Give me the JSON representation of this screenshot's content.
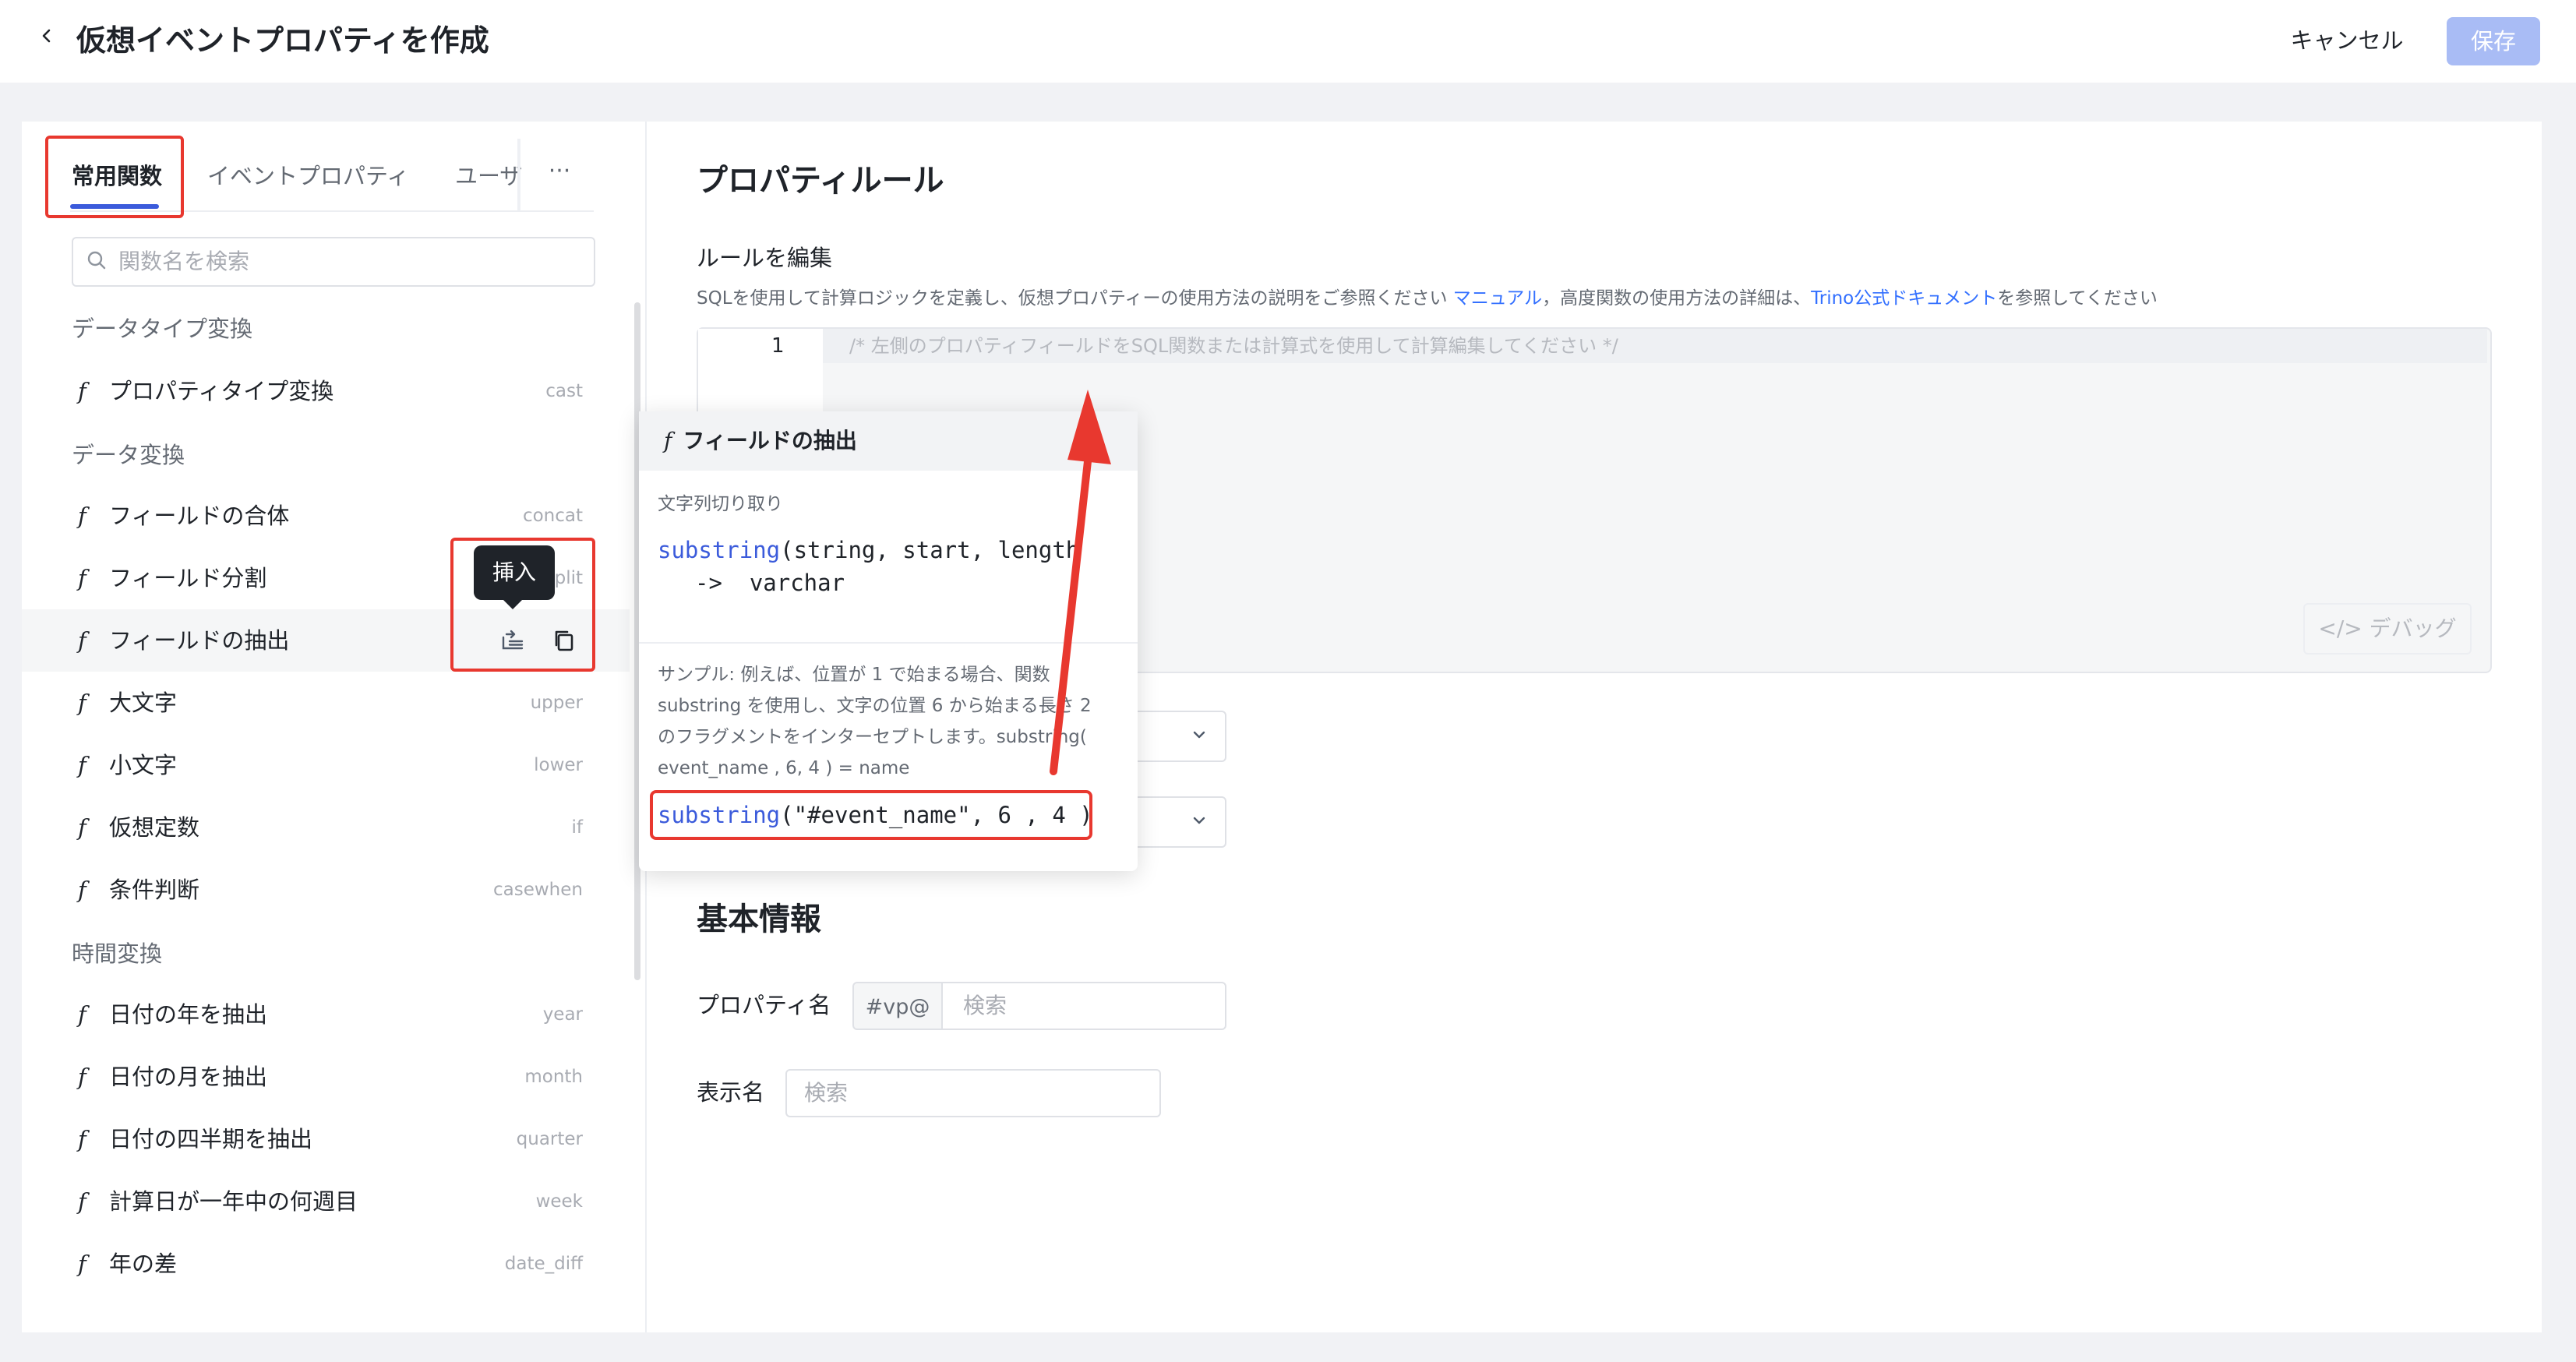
{
  "header": {
    "title": "仮想イベントプロパティを作成",
    "cancel_label": "キャンセル",
    "save_label": "保存"
  },
  "left_panel": {
    "tabs": [
      {
        "label": "常用関数",
        "active": true
      },
      {
        "label": "イベントプロパティ",
        "active": false
      },
      {
        "label": "ユーザ",
        "active": false
      }
    ],
    "more_label": "···",
    "search_placeholder": "関数名を検索",
    "sections": [
      {
        "title": "データタイプ変換",
        "items": [
          {
            "label": "プロパティタイプ変換",
            "key": "cast"
          }
        ]
      },
      {
        "title": "データ変換",
        "items": [
          {
            "label": "フィールドの合体",
            "key": "concat"
          },
          {
            "label": "フィールド分割",
            "key": "split"
          },
          {
            "label": "フィールドの抽出",
            "key": ""
          },
          {
            "label": "大文字",
            "key": "upper"
          },
          {
            "label": "小文字",
            "key": "lower"
          },
          {
            "label": "仮想定数",
            "key": "if"
          },
          {
            "label": "条件判断",
            "key": "casewhen"
          }
        ]
      },
      {
        "title": "時間変換",
        "items": [
          {
            "label": "日付の年を抽出",
            "key": "year"
          },
          {
            "label": "日付の月を抽出",
            "key": "month"
          },
          {
            "label": "日付の四半期を抽出",
            "key": "quarter"
          },
          {
            "label": "計算日が一年中の何週目",
            "key": "week"
          },
          {
            "label": "年の差",
            "key": "date_diff"
          }
        ]
      }
    ],
    "fn_mark": "f",
    "insert_tooltip": "挿入"
  },
  "popover": {
    "mark": "f",
    "title": "フィールドの抽出",
    "subtitle": "文字列切り取り",
    "signature_fn": "substring",
    "signature_args": "(string, start, length",
    "signature_ret_arrow": "->",
    "signature_ret": "varchar",
    "sample_text_1": "サンプル: 例えば、位置が 1 で始まる場合、関数",
    "sample_text_2": "substring を使用し、文字の位置 6 から始まる長さ 2",
    "sample_text_3": "のフラグメントをインターセプトします。substring(",
    "sample_text_4": "event_name , 6, 4 ) = name",
    "sample_fn": "substring",
    "sample_args": "(\"#event_name\", 6 , 4 )"
  },
  "right_panel": {
    "rule_section_title": "プロパティルール",
    "rule_label": "ルールを編集",
    "rule_desc_1": "SQLを使用して計算ロジックを定義し、仮想プロパティーの使用方法の説明をご参照ください ",
    "rule_desc_link1": "マニュアル",
    "rule_desc_2": "，高度関数の使用方法の詳細は、",
    "rule_desc_link2": "Trino公式ドキュメント",
    "rule_desc_3": "を参照してください",
    "editor_line_number": "1",
    "editor_placeholder": "/* 左側のプロパティフィールドをSQL関数または計算式を使用して計算編集してください */",
    "debug_label": "</> デバッグ",
    "basic_section_title": "基本情報",
    "property_name_label": "プロパティ名",
    "property_prefix": "#vp@",
    "property_name_placeholder": "検索",
    "display_name_label": "表示名",
    "display_name_placeholder": "検索"
  },
  "colors": {
    "accent": "#3b5bdb",
    "link": "#3370ff",
    "save_disabled": "#a9bcf5",
    "annotation_red": "#e8382f"
  }
}
